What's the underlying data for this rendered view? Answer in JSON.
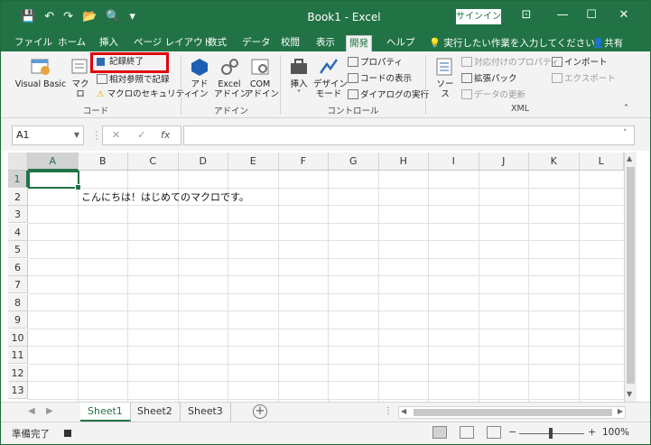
{
  "app": {
    "title": "Book1  -  Excel",
    "signin_label": "サインイン",
    "window_icons": [
      "ribbon-display-icon",
      "minimize-icon",
      "maximize-icon",
      "close-icon"
    ]
  },
  "qat": {
    "save_icon": "💾",
    "undo_icon": "↶",
    "redo_icon": "↷",
    "open_icon": "📂",
    "preview_icon": "🔍",
    "customize_icon": "▾"
  },
  "tabs": [
    {
      "label": "ファイル"
    },
    {
      "label": "ホーム"
    },
    {
      "label": "挿入"
    },
    {
      "label": "ページ レイアウト"
    },
    {
      "label": "数式"
    },
    {
      "label": "データ"
    },
    {
      "label": "校閲"
    },
    {
      "label": "表示"
    },
    {
      "label": "開発",
      "active": true
    },
    {
      "label": "ヘルプ"
    }
  ],
  "tellme": "実行したい作業を入力してください",
  "share": "共有",
  "ribbon": {
    "code": {
      "label": "コード",
      "visual_basic": "Visual Basic",
      "macro": "マクロ",
      "stop_recording": "記録終了",
      "relative_ref": "相対参照で記録",
      "macro_security": "マクロのセキュリティ"
    },
    "addins": {
      "label": "アドイン",
      "addin": "アド\nイン",
      "excel_addin": "Excel\nアドイン",
      "com_addin": "COM\nアドイン"
    },
    "controls": {
      "label": "コントロール",
      "insert": "挿入",
      "design_mode": "デザイン\nモード",
      "properties": "プロパティ",
      "view_code": "コードの表示",
      "run_dialog": "ダイアログの実行"
    },
    "xml": {
      "label": "XML",
      "source": "ソース",
      "map_properties": "対応付けのプロパティ",
      "expansion_packs": "拡張パック",
      "refresh_data": "データの更新",
      "import": "インポート",
      "export": "エクスポート"
    }
  },
  "formula_bar": {
    "name_box": "A1",
    "cancel": "✕",
    "enter": "✓",
    "fx": "fx",
    "value": ""
  },
  "columns": [
    "A",
    "B",
    "C",
    "D",
    "E",
    "F",
    "G",
    "H",
    "I",
    "J",
    "K",
    "L"
  ],
  "rows": [
    "1",
    "2",
    "3",
    "4",
    "5",
    "6",
    "7",
    "8",
    "9",
    "10",
    "11",
    "12",
    "13"
  ],
  "cells": {
    "B2": "こんにちは！はじめてのマクロです。"
  },
  "sheets": [
    {
      "label": "Sheet1",
      "active": true
    },
    {
      "label": "Sheet2"
    },
    {
      "label": "Sheet3"
    }
  ],
  "status": {
    "text": "準備完了",
    "zoom": "100%",
    "zoom_minus": "−",
    "zoom_plus": "+"
  }
}
